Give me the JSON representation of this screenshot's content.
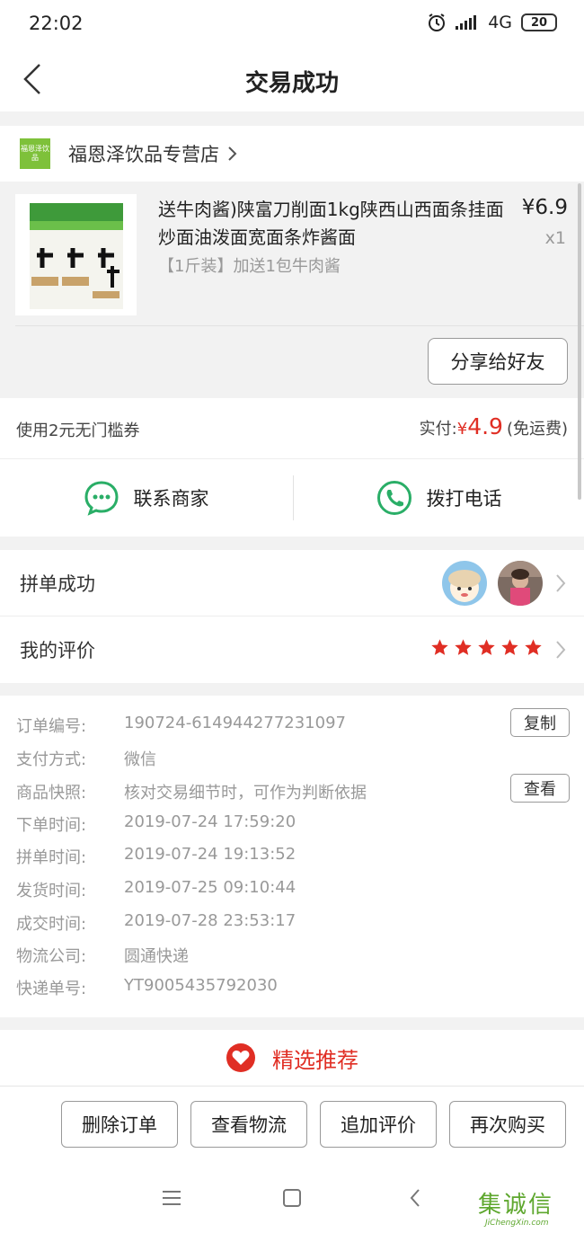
{
  "status_bar": {
    "time": "22:02",
    "network": "4G",
    "battery": "20"
  },
  "nav": {
    "title": "交易成功"
  },
  "store": {
    "logo_text": "福恩泽饮品",
    "name": "福恩泽饮品专营店"
  },
  "product": {
    "title": "送牛肉酱)陕富刀削面1kg陕西山西面条挂面炒面油泼面宽面条炸酱面",
    "price": "¥6.9",
    "quantity": "x1",
    "spec": "【1斤装】加送1包牛肉酱",
    "share_label": "分享给好友"
  },
  "coupon": {
    "text": "使用2元无门槛券",
    "paid_label": "实付:",
    "currency": "¥",
    "paid_amount": "4.9",
    "shipping_note": "(免运费)"
  },
  "contact": {
    "merchant_label": "联系商家",
    "phone_label": "拨打电话"
  },
  "group": {
    "label": "拼单成功"
  },
  "review": {
    "label": "我的评价",
    "rating": 5,
    "max_rating": 5
  },
  "order_info": {
    "rows": [
      {
        "label": "订单编号:",
        "value": "190724-614944277231097"
      },
      {
        "label": "支付方式:",
        "value": "微信"
      },
      {
        "label": "商品快照:",
        "value": "核对交易细节时，可作为判断依据"
      },
      {
        "label": "下单时间:",
        "value": "2019-07-24 17:59:20"
      },
      {
        "label": "拼单时间:",
        "value": "2019-07-24 19:13:52"
      },
      {
        "label": "发货时间:",
        "value": "2019-07-25 09:10:44"
      },
      {
        "label": "成交时间:",
        "value": "2019-07-28 23:53:17"
      },
      {
        "label": "物流公司:",
        "value": "圆通快递"
      },
      {
        "label": "快递单号:",
        "value": "YT9005435792030"
      }
    ],
    "copy_label": "复制",
    "view_label": "查看"
  },
  "recommend": {
    "label": "精选推荐"
  },
  "actions": {
    "delete": "删除订单",
    "logistics": "查看物流",
    "add_review": "追加评价",
    "buy_again": "再次购买"
  },
  "watermark": {
    "main": "集诚信",
    "sub": "JiChengXin.com"
  },
  "colors": {
    "accent": "#e02e24",
    "wechat_green": "#2aae67",
    "store_green": "#7ec13a"
  }
}
